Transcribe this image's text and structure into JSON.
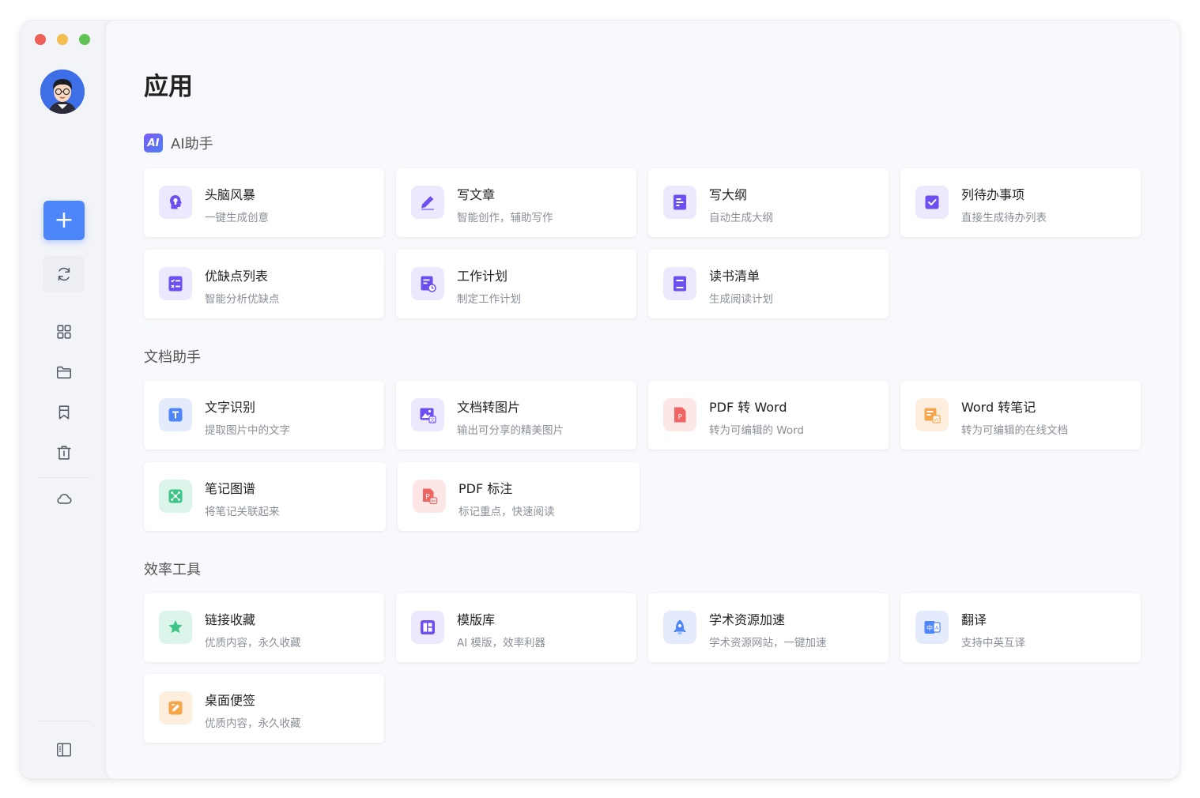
{
  "page": {
    "title": "应用"
  },
  "sidebar": {
    "new_button_label": "+",
    "items": [
      {
        "icon": "sync-icon"
      },
      {
        "icon": "grid-icon"
      },
      {
        "icon": "folder-icon"
      },
      {
        "icon": "bookmark-icon"
      },
      {
        "icon": "trash-icon"
      },
      {
        "icon": "cloud-icon"
      },
      {
        "icon": "sidebar-toggle-icon"
      }
    ]
  },
  "sections": {
    "ai": {
      "badge": "AI",
      "title": "AI助手",
      "cards": [
        {
          "title": "头脑风暴",
          "desc": "一键生成创意"
        },
        {
          "title": "写文章",
          "desc": "智能创作，辅助写作"
        },
        {
          "title": "写大纲",
          "desc": "自动生成大纲"
        },
        {
          "title": "列待办事项",
          "desc": "直接生成待办列表"
        },
        {
          "title": "优缺点列表",
          "desc": "智能分析优缺点"
        },
        {
          "title": "工作计划",
          "desc": "制定工作计划"
        },
        {
          "title": "读书清单",
          "desc": "生成阅读计划"
        }
      ]
    },
    "docs": {
      "title": "文档助手",
      "cards": [
        {
          "title": "文字识别",
          "desc": "提取图片中的文字"
        },
        {
          "title": "文档转图片",
          "desc": "输出可分享的精美图片"
        },
        {
          "title": "PDF 转 Word",
          "desc": "转为可编辑的 Word"
        },
        {
          "title": "Word 转笔记",
          "desc": "转为可编辑的在线文档"
        },
        {
          "title": "笔记图谱",
          "desc": "将笔记关联起来"
        },
        {
          "title": "PDF 标注",
          "desc": "标记重点，快速阅读"
        }
      ]
    },
    "tools": {
      "title": "效率工具",
      "cards": [
        {
          "title": "链接收藏",
          "desc": "优质内容，永久收藏"
        },
        {
          "title": "模版库",
          "desc": "AI 模版，效率利器"
        },
        {
          "title": "学术资源加速",
          "desc": "学术资源网站，一键加速"
        },
        {
          "title": "翻译",
          "desc": "支持中英互译"
        },
        {
          "title": "桌面便签",
          "desc": "优质内容，永久收藏"
        }
      ]
    }
  },
  "colors": {
    "accent": "#4c86f8",
    "ai_purple": "#7b5cf5",
    "pdf_red": "#f06464",
    "word_orange": "#f5a64a",
    "green": "#3ec487"
  }
}
